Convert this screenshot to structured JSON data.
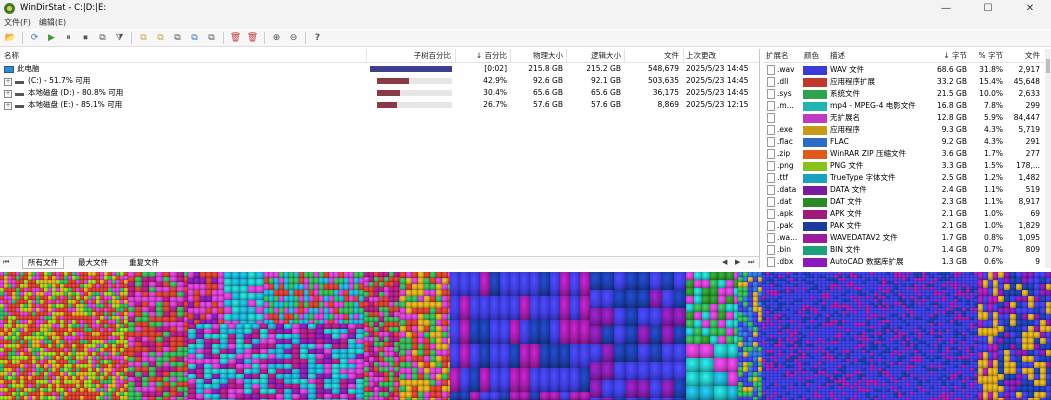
{
  "window": {
    "title": "WinDirStat - C:|D:|E:",
    "minimize": "—",
    "maximize": "☐",
    "close": "✕"
  },
  "menu": [
    "文件(F)",
    "编辑(E)"
  ],
  "toolbar": [
    "📂",
    "⟳",
    "▶",
    "⏸",
    "⏹",
    "⧉",
    "⧩",
    "⧉",
    "⧉",
    "⧉",
    "⧉",
    "⧉",
    "🗑",
    "🗑",
    "⊕",
    "⊖",
    "?"
  ],
  "tree": {
    "columns": {
      "name": "名称",
      "subtree": "子树百分比",
      "percent": "↓ 百分比",
      "physical": "物理大小",
      "logical": "逻辑大小",
      "files": "文件",
      "modified": "上次更改"
    },
    "rows": [
      {
        "name": "此电脑",
        "subtree_fraction": 1.0,
        "percent": "[0:02]",
        "physical": "215.8 GB",
        "logical": "215.2 GB",
        "files": "548,679",
        "modified": "2025/5/23  14:45",
        "bar_color": "#3f3f8f"
      },
      {
        "name": "(C:) - 51.7% 可用",
        "subtree_fraction": 0.429,
        "percent": "42.9%",
        "physical": "92.6 GB",
        "logical": "92.1 GB",
        "files": "503,635",
        "modified": "2025/5/23  14:45",
        "bar_color": "#8a3a46"
      },
      {
        "name": "本地磁盘 (D:) - 80.8% 可用",
        "subtree_fraction": 0.304,
        "percent": "30.4%",
        "physical": "65.6 GB",
        "logical": "65.6 GB",
        "files": "36,175",
        "modified": "2025/5/23  14:45",
        "bar_color": "#8a3a46"
      },
      {
        "name": "本地磁盘 (E:) - 85.1% 可用",
        "subtree_fraction": 0.267,
        "percent": "26.7%",
        "physical": "57.6 GB",
        "logical": "57.6 GB",
        "files": "8,869",
        "modified": "2025/5/23  12:15",
        "bar_color": "#8a3a46"
      }
    ]
  },
  "tabs": [
    "所有文件",
    "最大文件",
    "重复文件"
  ],
  "tab_nav": {
    "prev": "◀",
    "next": "▶",
    "first": "⏮"
  },
  "extensions": {
    "columns": {
      "ext": "扩展名",
      "color": "颜色",
      "desc": "描述",
      "bytes": "↓ 字节",
      "pct": "% 字节",
      "files": "文件"
    },
    "rows": [
      {
        "ext": ".wav",
        "color": "#3a3ad8",
        "desc": "WAV 文件",
        "bytes": "68.6 GB",
        "pct": "31.8%",
        "files": "2,917"
      },
      {
        "ext": ".dll",
        "color": "#c0392b",
        "desc": "应用程序扩展",
        "bytes": "33.2 GB",
        "pct": "15.4%",
        "files": "45,648"
      },
      {
        "ext": ".sys",
        "color": "#2ea44f",
        "desc": "系统文件",
        "bytes": "21.5 GB",
        "pct": "10.0%",
        "files": "2,633"
      },
      {
        "ext": ".m...",
        "color": "#1fb5b5",
        "desc": "mp4 - MPEG-4 电影文件",
        "bytes": "16.8 GB",
        "pct": "7.8%",
        "files": "299"
      },
      {
        "ext": "",
        "color": "#c03ac0",
        "desc": "无扩展名",
        "bytes": "12.8 GB",
        "pct": "5.9%",
        "files": "84,447"
      },
      {
        "ext": ".exe",
        "color": "#c79a1a",
        "desc": "应用程序",
        "bytes": "9.3 GB",
        "pct": "4.3%",
        "files": "5,719"
      },
      {
        "ext": ".flac",
        "color": "#2b6cc8",
        "desc": "FLAC",
        "bytes": "9.2 GB",
        "pct": "4.3%",
        "files": "291"
      },
      {
        "ext": ".zip",
        "color": "#e05a1a",
        "desc": "WinRAR ZIP 压缩文件",
        "bytes": "3.6 GB",
        "pct": "1.7%",
        "files": "277"
      },
      {
        "ext": ".png",
        "color": "#8ac01a",
        "desc": "PNG 文件",
        "bytes": "3.3 GB",
        "pct": "1.5%",
        "files": "178,..."
      },
      {
        "ext": ".ttf",
        "color": "#1aa0c0",
        "desc": "TrueType 字体文件",
        "bytes": "2.5 GB",
        "pct": "1.2%",
        "files": "1,482"
      },
      {
        "ext": ".data",
        "color": "#7a1aa0",
        "desc": "DATA 文件",
        "bytes": "2.4 GB",
        "pct": "1.1%",
        "files": "519"
      },
      {
        "ext": ".dat",
        "color": "#2a8a2a",
        "desc": "DAT 文件",
        "bytes": "2.3 GB",
        "pct": "1.1%",
        "files": "8,917"
      },
      {
        "ext": ".apk",
        "color": "#a01a7a",
        "desc": "APK 文件",
        "bytes": "2.1 GB",
        "pct": "1.0%",
        "files": "69"
      },
      {
        "ext": ".pak",
        "color": "#1a3aa0",
        "desc": "PAK 文件",
        "bytes": "2.1 GB",
        "pct": "1.0%",
        "files": "1,829"
      },
      {
        "ext": ".wa...",
        "color": "#9a1aa0",
        "desc": "WAVEDATAV2 文件",
        "bytes": "1.7 GB",
        "pct": "0.8%",
        "files": "1,095"
      },
      {
        "ext": ".bin",
        "color": "#1aa07a",
        "desc": "BIN 文件",
        "bytes": "1.4 GB",
        "pct": "0.7%",
        "files": "809"
      },
      {
        "ext": ".dbx",
        "color": "#8a1ac0",
        "desc": "AutoCAD 数据库扩展",
        "bytes": "1.3 GB",
        "pct": "0.6%",
        "files": "9"
      }
    ]
  }
}
